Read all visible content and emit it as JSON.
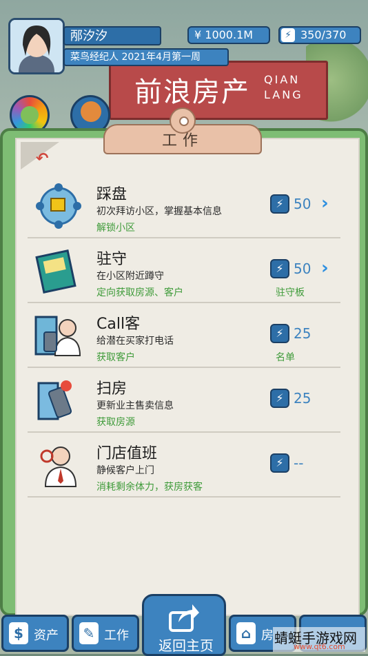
{
  "header": {
    "player_name": "邴汐汐",
    "player_title": "菜鸟经纪人 2021年4月第一周",
    "money": "¥ 1000.1M",
    "energy": "350/370",
    "store_name_cn": "前浪房产",
    "store_name_en_1": "QIAN",
    "store_name_en_2": "LANG"
  },
  "panel": {
    "tab_label": "工作",
    "rows": [
      {
        "title": "踩盘",
        "desc": "初次拜访小区，掌握基本信息",
        "sub": "解锁小区",
        "cost": "50",
        "extra": "",
        "icon": "neighborhood-map-icon"
      },
      {
        "title": "驻守",
        "desc": "在小区附近蹲守",
        "sub": "定向获取房源、客户",
        "cost": "50",
        "extra": "驻守板",
        "icon": "brochure-icon"
      },
      {
        "title": "Call客",
        "desc": "给潜在买家打电话",
        "sub": "获取客户",
        "cost": "25",
        "extra": "名单",
        "icon": "phone-agent-icon"
      },
      {
        "title": "扫房",
        "desc": "更新业主售卖信息",
        "sub": "获取房源",
        "cost": "25",
        "extra": "",
        "icon": "building-phone-icon"
      },
      {
        "title": "门店值班",
        "desc": "静候客户上门",
        "sub": "消耗剩余体力，获房获客",
        "cost": "--",
        "extra": "",
        "icon": "agent-on-call-icon"
      }
    ]
  },
  "nav": {
    "assets_label": "资产",
    "work_label": "工作",
    "home_label": "返回主页",
    "house_label": "房"
  },
  "watermark": {
    "line1": "蜻蜓手游戏网",
    "line2": "www.qt6.com"
  },
  "colors": {
    "accent_blue": "#3d83bf",
    "green_text": "#3f9b3a",
    "frame_green": "#7ebd74"
  }
}
